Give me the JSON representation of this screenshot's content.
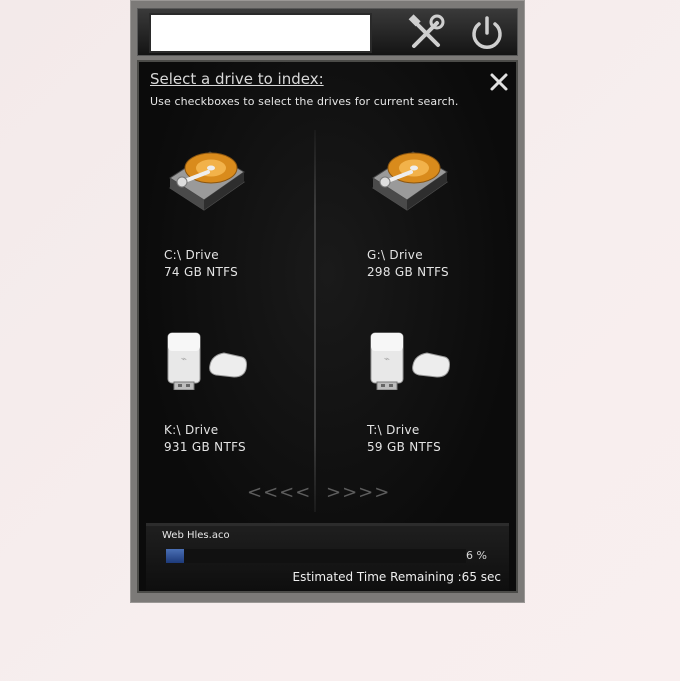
{
  "search": {
    "value": "",
    "placeholder": ""
  },
  "toolbar": {
    "tools_icon": "tools-icon",
    "power_icon": "power-icon"
  },
  "panel": {
    "title": "Select a drive to index:",
    "subtitle": "Use checkboxes to select the drives for current search.",
    "close_icon": "close-icon"
  },
  "drives": [
    {
      "name": "C:\\ Drive",
      "size": "74 GB NTFS",
      "icon": "hard-drive-icon"
    },
    {
      "name": "G:\\ Drive",
      "size": "298 GB NTFS",
      "icon": "hard-drive-icon"
    },
    {
      "name": "K:\\ Drive",
      "size": "931 GB NTFS",
      "icon": "usb-drive-icon"
    },
    {
      "name": "T:\\ Drive",
      "size": "59 GB NTFS",
      "icon": "usb-drive-icon"
    }
  ],
  "nav": {
    "prev": "<<<<",
    "next": ">>>>"
  },
  "status": {
    "file": "Web Hles.aco",
    "percent_label": "6 %",
    "percent": 6,
    "eta": "Estimated Time Remaining :65 sec"
  },
  "colors": {
    "progress": "#2d55a8",
    "panel_bg": "#0e0e0e",
    "frame": "#7c7a78"
  }
}
